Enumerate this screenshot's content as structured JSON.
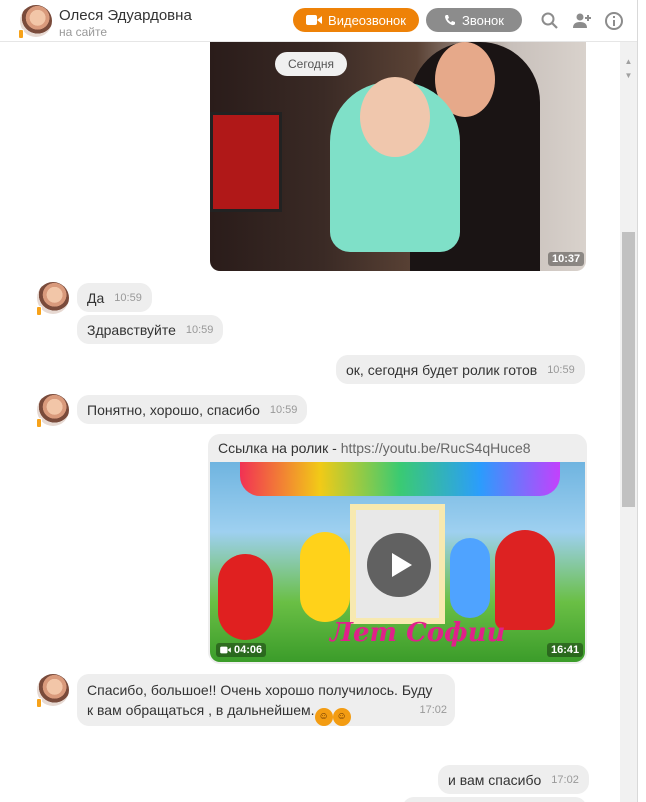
{
  "header": {
    "name": "Олеся Эдуардовна",
    "status": "на сайте",
    "video_label": "Видеозвонок",
    "call_label": "Звонок"
  },
  "chat": {
    "date_chip": "Сегодня",
    "photo_time": "10:37",
    "messages": [
      {
        "text": "Да",
        "time": "10:59"
      },
      {
        "text": "Здравствуйте",
        "time": "10:59"
      },
      {
        "text": "ок, сегодня будет ролик готов",
        "time": "10:59"
      },
      {
        "text": "Понятно, хорошо, спасибо",
        "time": "10:59"
      },
      {
        "text": "и вам спасибо",
        "time": "17:02"
      }
    ],
    "link": {
      "prefix": "Ссылка на ролик - ",
      "url": "https://youtu.be/RucS4qHuce8",
      "duration": "04:06",
      "time": "16:41",
      "video_title": "Лет Софии"
    },
    "long_message": {
      "line1": "Спасибо, большое!! Очень хорошо получилось.  Буду",
      "line2": "к вам обращаться , в дальнейшем.",
      "time": "17:02"
    }
  }
}
